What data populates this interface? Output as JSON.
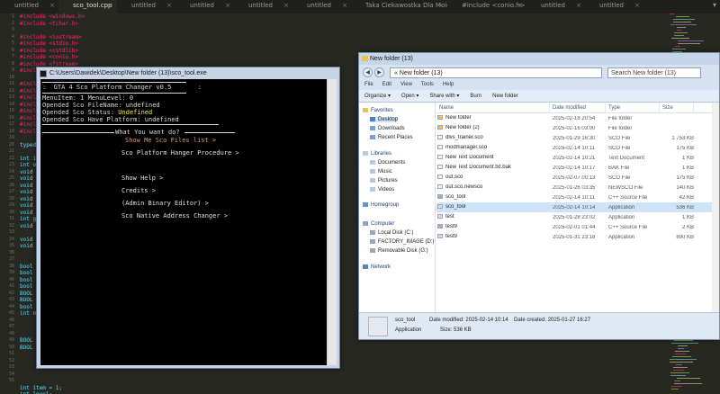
{
  "editor": {
    "tabs": [
      {
        "label": "untitled",
        "active": false
      },
      {
        "label": "sco_tool.cpp",
        "active": true
      },
      {
        "label": "untitled",
        "active": false
      },
      {
        "label": "untitled",
        "active": false
      },
      {
        "label": "untitled",
        "active": false
      },
      {
        "label": "untitled",
        "active": false
      },
      {
        "label": "Taka Ciekawostka Dla Moich Fanów",
        "active": false
      },
      {
        "label": "#include <conio.h>",
        "active": false
      },
      {
        "label": "untitled",
        "active": false
      },
      {
        "label": "untitled",
        "active": false
      }
    ],
    "line_numbers": [
      "1",
      "2",
      "3",
      "4",
      "5",
      "6",
      "7",
      "8",
      "9",
      "10",
      "11",
      "12",
      "13",
      "14",
      "15",
      "16",
      "17",
      "18",
      "19",
      "20",
      "21",
      "22",
      "23",
      "24",
      "25",
      "26",
      "27",
      "28",
      "29",
      "30",
      "31",
      "32",
      "33",
      "34",
      "35",
      "36",
      "37",
      "38",
      "39",
      "40",
      "41",
      "42",
      "43",
      "44",
      "45",
      "46",
      "47",
      "48",
      "49",
      "50",
      "51",
      "52",
      "53",
      "54",
      "55"
    ],
    "code_lines": [
      "#include <windows.h>",
      "#include <tchar.h>",
      "",
      "#include <iostream>",
      "#include <stdio.h>",
      "#include <cstdlib>",
      "#include <conio.h>",
      "#include <fstream>",
      "#include",
      "",
      "#include",
      "#include",
      "#include",
      "#include",
      "#include",
      "#include",
      "#include",
      "#include",
      "",
      "typede",
      "",
      "int id",
      "int op",
      "void s",
      "void r",
      "void w",
      "void E",
      "void E",
      "void u",
      "void c",
      "int ge",
      "void m",
      "",
      "void m",
      "void n",
      "",
      "",
      "bool S",
      "bool B",
      "bool s",
      "bool A",
      "BOOL f",
      "BOOL f",
      "bool n",
      "int ne",
      "",
      "",
      "",
      "BOOL E",
      "BOOL e",
      "",
      "",
      "",
      "",
      "",
      "int item = 1;",
      "int level;",
      "int stepstart = 1;"
    ]
  },
  "console": {
    "title": "C:\\Users\\Dawidek\\Desktop\\New folder (13)\\sco_tool.exe",
    "banner": ":  GTA 4 Sco Platform Changer v0.5       :",
    "status_lines": [
      "MenuItem: 1 MenuLevel: 0",
      "Opended Sco FileName: undefined",
      "Opended Sco Status: ",
      "Opended Sco Have Platform: undefined"
    ],
    "status_highlight": "Undefined",
    "question": "What You want do?",
    "menu": [
      {
        "label": "Show Me Sco Files list >",
        "selected": true
      },
      {
        "label": "Sco Platform Hanger Procedure >",
        "selected": false
      },
      {
        "label": "",
        "selected": false
      },
      {
        "label": "Show Help >",
        "selected": false
      },
      {
        "label": "Credits >",
        "selected": false
      },
      {
        "label": "(Admin Binary Editor) >",
        "selected": false
      },
      {
        "label": "Sco Native Address Changer >",
        "selected": false
      }
    ]
  },
  "explorer": {
    "title": "New folder (13)",
    "address": "« New folder (13)",
    "search_placeholder": "Search New folder (13)",
    "menu": [
      "File",
      "Edit",
      "View",
      "Tools",
      "Help"
    ],
    "toolbar": [
      "Organize ▾",
      "Open ▾",
      "Share with ▾",
      "Burn",
      "New folder"
    ],
    "nav": {
      "favorites_header": "Favorites",
      "favorites": [
        "Desktop",
        "Downloads",
        "Recent Places"
      ],
      "libraries_header": "Libraries",
      "libraries": [
        "Documents",
        "Music",
        "Pictures",
        "Videos"
      ],
      "homegroup": "Homegroup",
      "computer_header": "Computer",
      "drives": [
        "Local Disk (C:)",
        "FACTORY_IMAGE (D:)",
        "Removable Disk (G:)"
      ],
      "network": "Network"
    },
    "columns": [
      "Name",
      "Date modified",
      "Type",
      "Size"
    ],
    "files": [
      {
        "name": "New folder",
        "date": "2025-02-18 20:54",
        "type": "File folder",
        "size": "",
        "icon": "folder"
      },
      {
        "name": "New folder (2)",
        "date": "2025-02-16 03:00",
        "type": "File folder",
        "size": "",
        "icon": "folder"
      },
      {
        "name": "dlvs_trainer.sco",
        "date": "2025-01-29 16:30",
        "type": "SCO File",
        "size": "1 753 KB",
        "icon": "file"
      },
      {
        "name": "modmanager.sco",
        "date": "2025-02-14 10:11",
        "type": "SCO File",
        "size": "175 KB",
        "icon": "file"
      },
      {
        "name": "New Text Document",
        "date": "2025-02-14 10:21",
        "type": "Text Document",
        "size": "1 KB",
        "icon": "file"
      },
      {
        "name": "New Text Document.txt.bak",
        "date": "2025-02-14 10:17",
        "type": "BAK File",
        "size": "1 KB",
        "icon": "file"
      },
      {
        "name": "out.sco",
        "date": "2025-02-07 00:13",
        "type": "SCO File",
        "size": "175 KB",
        "icon": "file"
      },
      {
        "name": "out.sco.newsco",
        "date": "2025-01-26 03:35",
        "type": "NEWSCO File",
        "size": "140 KB",
        "icon": "file"
      },
      {
        "name": "sco_tool",
        "date": "2025-02-14 10:11",
        "type": "C++ Source File",
        "size": "42 KB",
        "icon": "cpp"
      },
      {
        "name": "sco_tool",
        "date": "2025-02-14 10:14",
        "type": "Application",
        "size": "536 KB",
        "icon": "exe",
        "selected": true
      },
      {
        "name": "test",
        "date": "2025-01-28 23:02",
        "type": "Application",
        "size": "1 KB",
        "icon": "exe"
      },
      {
        "name": "test9",
        "date": "2025-02-01 01:44",
        "type": "C++ Source File",
        "size": "2 KB",
        "icon": "cpp"
      },
      {
        "name": "test9",
        "date": "2025-01-31 23:18",
        "type": "Application",
        "size": "890 KB",
        "icon": "exe"
      }
    ],
    "details": {
      "name": "sco_tool",
      "modified": "Date modified: 2025-02-14 10:14",
      "created": "Date created: 2025-01-27 16:27",
      "type": "Application",
      "size": "Size: 536 KB"
    }
  }
}
